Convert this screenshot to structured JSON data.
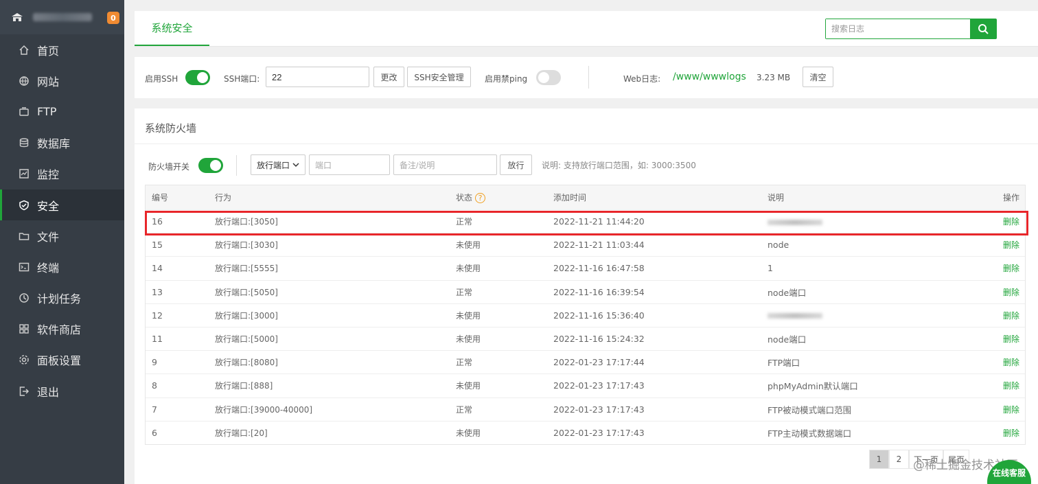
{
  "sidebar": {
    "badge": "0",
    "items": [
      {
        "label": "首页",
        "icon": "home-icon"
      },
      {
        "label": "网站",
        "icon": "globe-icon"
      },
      {
        "label": "FTP",
        "icon": "ftp-icon"
      },
      {
        "label": "数据库",
        "icon": "database-icon"
      },
      {
        "label": "监控",
        "icon": "monitor-icon"
      },
      {
        "label": "安全",
        "icon": "shield-icon"
      },
      {
        "label": "文件",
        "icon": "folder-icon"
      },
      {
        "label": "终端",
        "icon": "terminal-icon"
      },
      {
        "label": "计划任务",
        "icon": "clock-icon"
      },
      {
        "label": "软件商店",
        "icon": "apps-icon"
      },
      {
        "label": "面板设置",
        "icon": "gear-icon"
      },
      {
        "label": "退出",
        "icon": "logout-icon"
      }
    ],
    "active_index": 5
  },
  "tabs": {
    "active": "系统安全"
  },
  "search": {
    "placeholder": "搜索日志"
  },
  "ssh": {
    "enable_label": "启用SSH",
    "port_label": "SSH端口:",
    "port_value": "22",
    "change_button": "更改",
    "manage_button": "SSH安全管理",
    "ping_label": "启用禁ping",
    "weblog_label": "Web日志:",
    "weblog_path": "/www/wwwlogs",
    "weblog_size": "3.23 MB",
    "clear_button": "清空"
  },
  "firewall": {
    "title": "系统防火墙",
    "switch_label": "防火墙开关",
    "select_value": "放行端口",
    "port_placeholder": "端口",
    "note_placeholder": "备注/说明",
    "allow_button": "放行",
    "help_text": "说明: 支持放行端口范围，如: 3000:3500"
  },
  "table": {
    "headers": [
      "编号",
      "行为",
      "状态",
      "添加时间",
      "说明",
      "操作"
    ],
    "rows": [
      {
        "id": "16",
        "action": "放行端口:[3050]",
        "status": "正常",
        "time": "2022-11-21 11:44:20",
        "note": "",
        "op": "删除"
      },
      {
        "id": "15",
        "action": "放行端口:[3030]",
        "status": "未使用",
        "time": "2022-11-21 11:03:44",
        "note": "node",
        "op": "删除"
      },
      {
        "id": "14",
        "action": "放行端口:[5555]",
        "status": "未使用",
        "time": "2022-11-16 16:47:58",
        "note": "1",
        "op": "删除"
      },
      {
        "id": "13",
        "action": "放行端口:[5050]",
        "status": "正常",
        "time": "2022-11-16 16:39:54",
        "note": "node端口",
        "op": "删除"
      },
      {
        "id": "12",
        "action": "放行端口:[3000]",
        "status": "未使用",
        "time": "2022-11-16 15:36:40",
        "note": "",
        "op": "删除"
      },
      {
        "id": "11",
        "action": "放行端口:[5000]",
        "status": "未使用",
        "time": "2022-11-16 15:24:32",
        "note": "node端口",
        "op": "删除"
      },
      {
        "id": "9",
        "action": "放行端口:[8080]",
        "status": "正常",
        "time": "2022-01-23 17:17:44",
        "note": "FTP端口",
        "op": "删除"
      },
      {
        "id": "8",
        "action": "放行端口:[888]",
        "status": "未使用",
        "time": "2022-01-23 17:17:43",
        "note": "phpMyAdmin默认端口",
        "op": "删除"
      },
      {
        "id": "7",
        "action": "放行端口:[39000-40000]",
        "status": "正常",
        "time": "2022-01-23 17:17:43",
        "note": "FTP被动模式端口范围",
        "op": "删除"
      },
      {
        "id": "6",
        "action": "放行端口:[20]",
        "status": "未使用",
        "time": "2022-01-23 17:17:43",
        "note": "FTP主动模式数据端口",
        "op": "删除"
      }
    ]
  },
  "pager": {
    "pages": [
      "1",
      "2"
    ],
    "next": "下一页",
    "last": "尾页"
  },
  "watermark": "@稀土掘金技术社区",
  "online_service": "在线客服",
  "colors": {
    "accent": "#20a53a",
    "sidebar": "#3c444d",
    "highlight": "#e8262a",
    "badge": "#f08b32"
  }
}
